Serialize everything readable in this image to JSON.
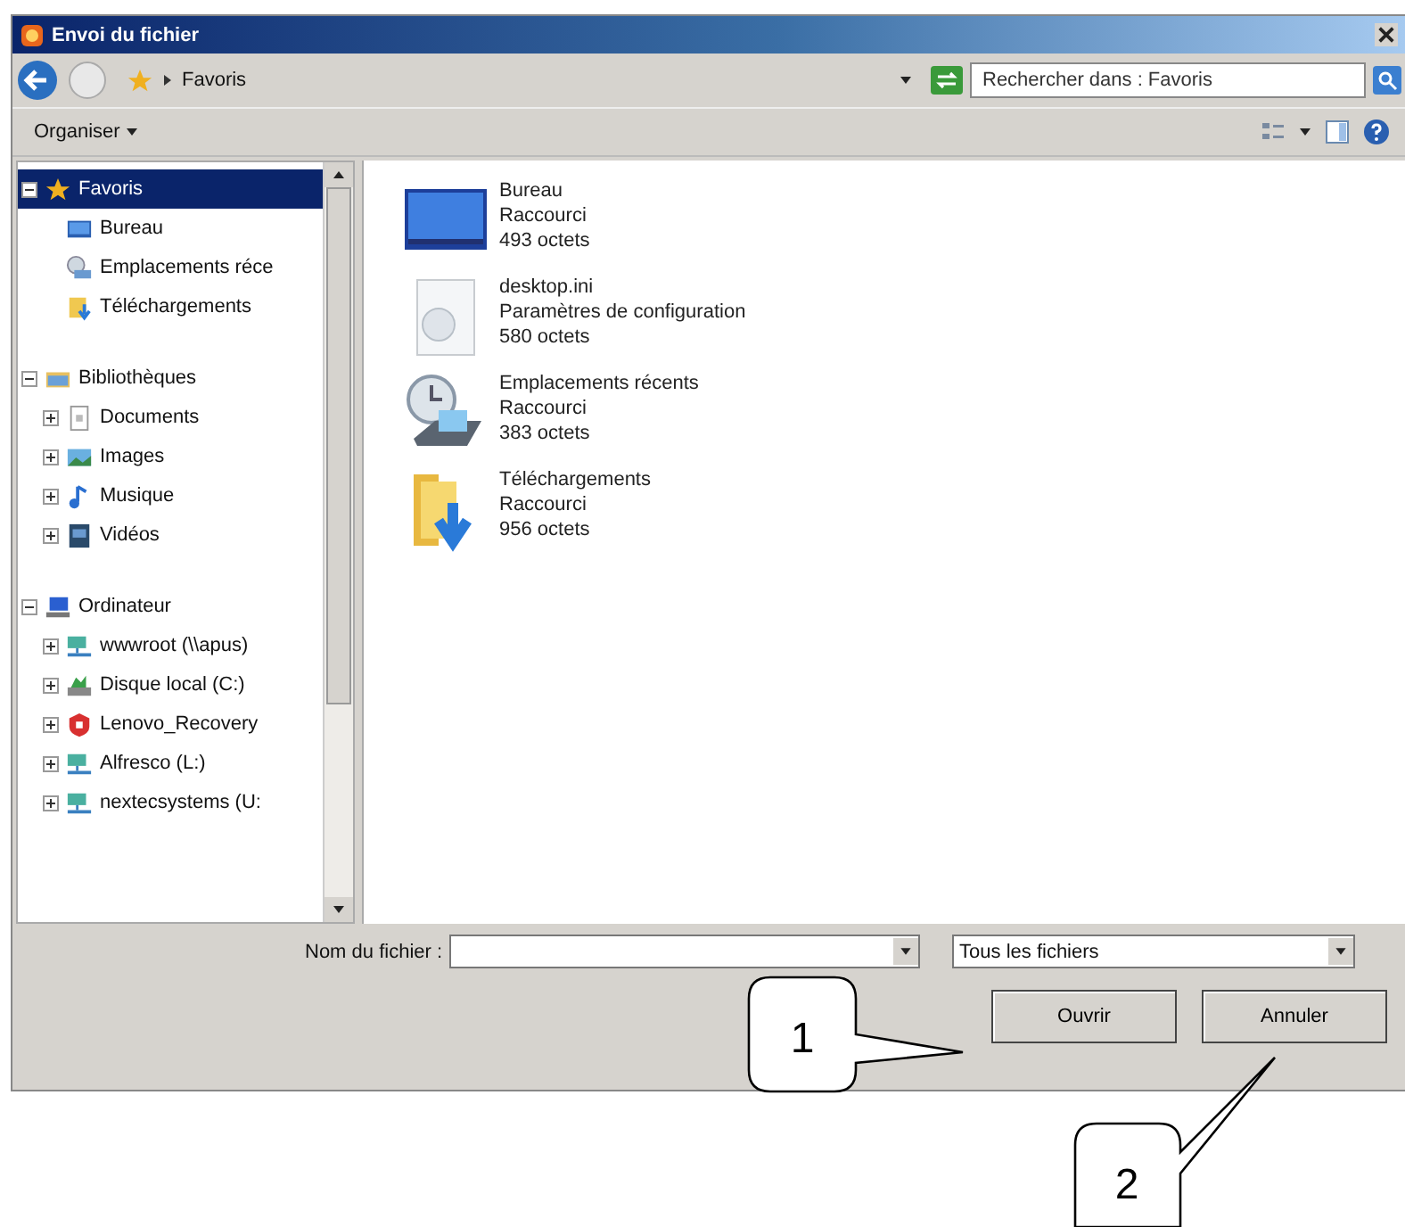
{
  "window": {
    "title": "Envoi du fichier"
  },
  "address_bar": {
    "path": "Favoris",
    "search_placeholder": "Rechercher dans : Favoris"
  },
  "toolbar": {
    "organize": "Organiser"
  },
  "tree": [
    {
      "label": "Favoris",
      "kind": "favorites",
      "expanded": true,
      "selected": true,
      "children": [
        {
          "label": "Bureau",
          "kind": "desktop",
          "selected": false
        },
        {
          "label": "Emplacements réce",
          "kind": "recent",
          "selected": false
        },
        {
          "label": "Téléchargements",
          "kind": "downloads",
          "selected": false
        }
      ]
    },
    {
      "label": "Bibliothèques",
      "kind": "library",
      "expanded": true,
      "selected": false,
      "children": [
        {
          "label": "Documents",
          "kind": "documents",
          "expanded": false,
          "selected": false
        },
        {
          "label": "Images",
          "kind": "images",
          "expanded": false,
          "selected": false
        },
        {
          "label": "Musique",
          "kind": "music",
          "expanded": false,
          "selected": false
        },
        {
          "label": "Vidéos",
          "kind": "videos",
          "expanded": false,
          "selected": false
        }
      ]
    },
    {
      "label": "Ordinateur",
      "kind": "computer",
      "expanded": true,
      "selected": false,
      "children": [
        {
          "label": "wwwroot (\\\\apus)",
          "kind": "network",
          "expanded": false,
          "selected": false
        },
        {
          "label": "Disque local (C:)",
          "kind": "disk",
          "expanded": false,
          "selected": false
        },
        {
          "label": "Lenovo_Recovery",
          "kind": "recovery",
          "expanded": false,
          "selected": false
        },
        {
          "label": "Alfresco (L:)",
          "kind": "network",
          "expanded": false,
          "selected": false
        },
        {
          "label": "nextecsystems (U:",
          "kind": "network",
          "expanded": false,
          "selected": false
        }
      ]
    }
  ],
  "files": [
    {
      "name": "Bureau",
      "type": "Raccourci",
      "size": "493 octets",
      "kind": "desktop"
    },
    {
      "name": "desktop.ini",
      "type": "Paramètres de configuration",
      "size": "580 octets",
      "kind": "settings"
    },
    {
      "name": "Emplacements récents",
      "type": "Raccourci",
      "size": "383 octets",
      "kind": "recent"
    },
    {
      "name": "Téléchargements",
      "type": "Raccourci",
      "size": "956 octets",
      "kind": "downloads"
    }
  ],
  "footer": {
    "filename_label": "Nom du fichier :",
    "filter": "Tous les fichiers",
    "buttons": [
      "Ouvrir",
      "Annuler"
    ]
  },
  "callouts": [
    {
      "label": "1"
    },
    {
      "label": "2"
    }
  ]
}
